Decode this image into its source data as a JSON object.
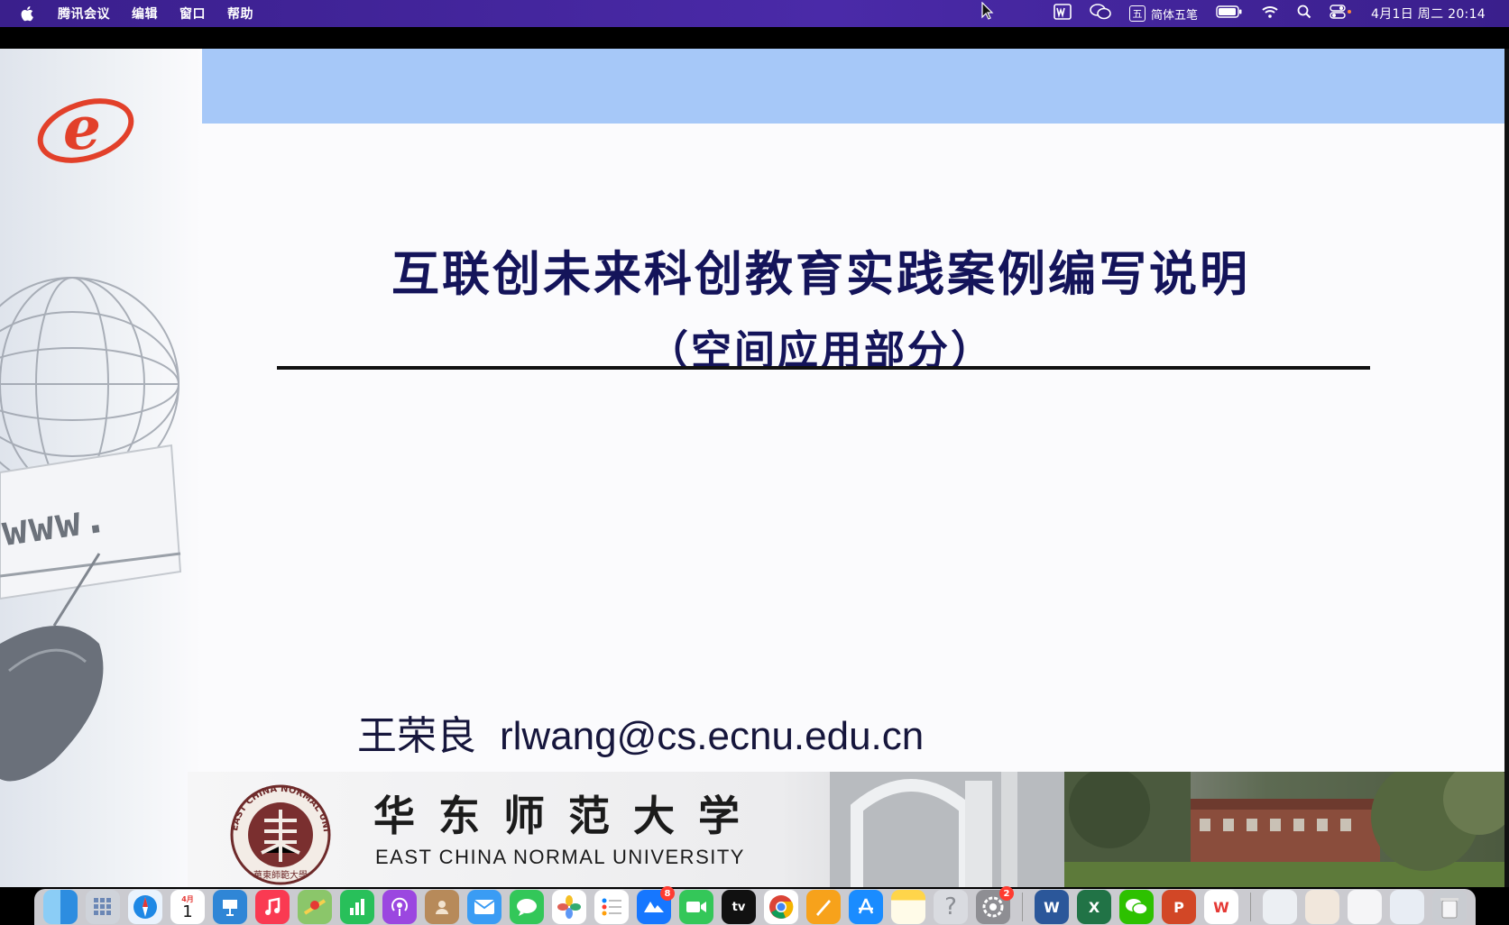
{
  "menubar": {
    "app_name": "腾讯会议",
    "menu_edit": "编辑",
    "menu_window": "窗口",
    "menu_help": "帮助",
    "ime_label": "简体五笔",
    "ime_icon_char": "五",
    "clock": "4月1日 周二 20:14"
  },
  "slide": {
    "title_line1": "互联创未来科创教育实践案例编写说明",
    "title_line2": "（空间应用部分）",
    "author_name": "王荣良",
    "author_email": "rlwang@cs.ecnu.edu.cn",
    "university_cn": "华东师范大学",
    "university_en": "EAST CHINA NORMAL UNIVERSITY",
    "seal_ring_text": "EAST CHINA NORMAL UNIVERSITY",
    "seal_bottom_text": "華東師範大學",
    "logo_letter": "e",
    "www_text": "www."
  },
  "dock": {
    "calendar_month": "4月",
    "calendar_day": "1",
    "appletv_label": "tv",
    "word_letter": "W",
    "excel_letter": "X",
    "ppt_letter": "P",
    "wps_letter": "W",
    "help_char": "?",
    "badges": {
      "lanxin": "8",
      "settings": "2"
    }
  },
  "colors": {
    "menubar": "#3a1f8c",
    "slide_topbar": "#a6c8f8",
    "title": "#14145a",
    "logo_red": "#e2402a"
  }
}
